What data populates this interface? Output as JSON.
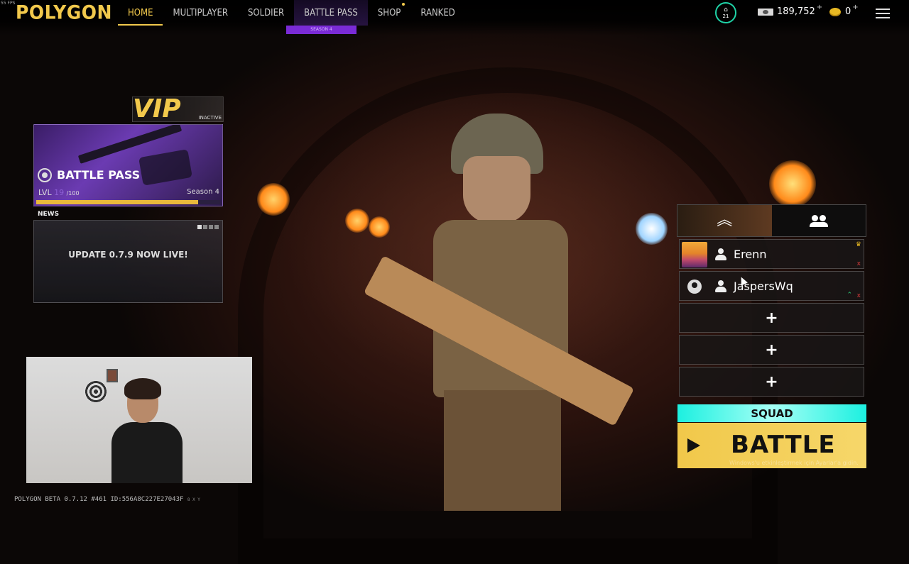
{
  "fps": "55 FPS",
  "logo": "POLYGON",
  "nav": {
    "items": [
      {
        "label": "HOME"
      },
      {
        "label": "MULTIPLAYER"
      },
      {
        "label": "SOLDIER"
      },
      {
        "label": "BATTLE PASS"
      },
      {
        "label": "SHOP"
      },
      {
        "label": "RANKED"
      }
    ],
    "battle_pass_tag": "SEASON 4"
  },
  "player": {
    "level": "21",
    "cash": "189,752",
    "gold": "0",
    "plus": "+"
  },
  "vip": {
    "label": "VIP",
    "status": "INACTIVE"
  },
  "battle_pass": {
    "title": "BATTLE PASS",
    "lvl_label": "LVL",
    "level": "19",
    "max": "/100",
    "season": "Season 4",
    "progress": 0.88
  },
  "news": {
    "label": "NEWS",
    "headline": "UPDATE 0.7.9 NOW LIVE!"
  },
  "footer": {
    "text": "POLYGON BETA 0.7.12 #461 ID:556A8C227E27043F",
    "extra": "8 X Y"
  },
  "squad": {
    "members": [
      {
        "name": "Erenn",
        "leader": "♛",
        "kick": "x"
      },
      {
        "name": "JaspersWq",
        "promote": "⌃",
        "kick": "x"
      }
    ],
    "empty_slot": "+",
    "label": "SQUAD",
    "battle": "BATTLE"
  },
  "watermark": "Windows'u etkinleştirmek için Ayarlar'a gidin.",
  "colors": {
    "accent": "#f2c94c",
    "squad": "#1cf0e0",
    "season": "#7a2bd6"
  }
}
